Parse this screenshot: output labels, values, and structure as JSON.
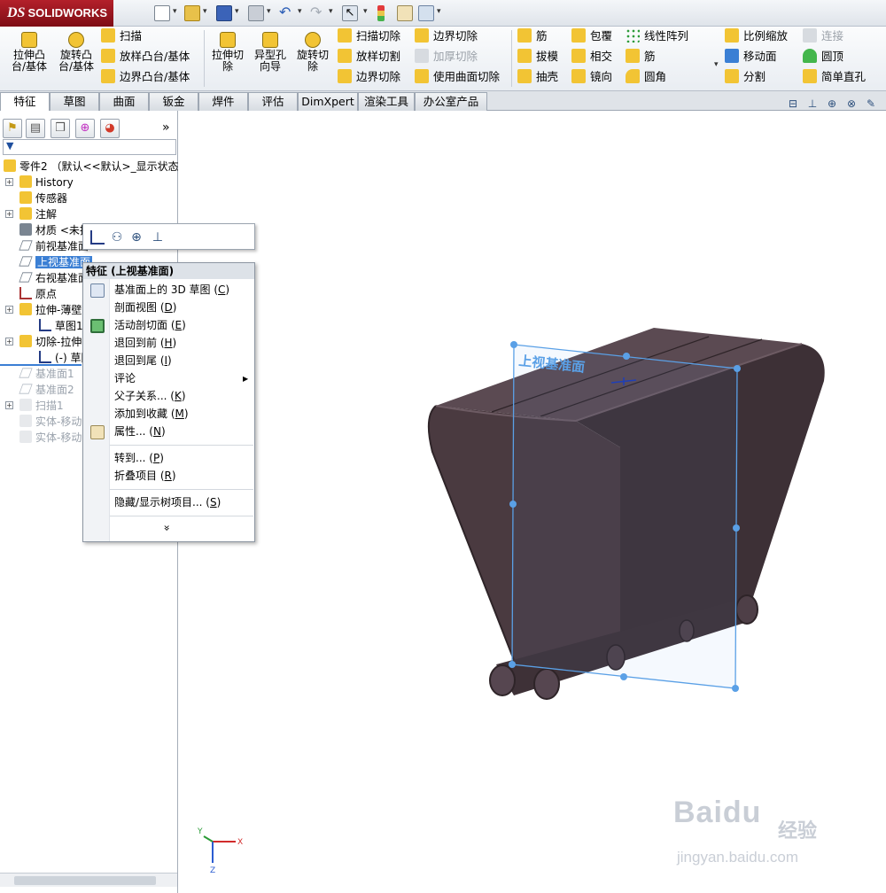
{
  "app": {
    "logo_text": "SOLIDWORKS",
    "logo_mark": "DS"
  },
  "titlebar_icons": [
    "new-icon",
    "open-icon",
    "save-icon",
    "print-icon",
    "undo-icon",
    "redo-icon",
    "select-icon",
    "traffic-light-icon",
    "options-icon",
    "customize-icon"
  ],
  "command_manager": {
    "big_buttons": [
      {
        "label1": "拉伸凸",
        "label2": "台/基体",
        "icon": "extrude-boss-icon"
      },
      {
        "label1": "旋转凸",
        "label2": "台/基体",
        "icon": "revolve-boss-icon"
      },
      {
        "label1": "拉伸切",
        "label2": "除",
        "icon": "extruded-cut-icon"
      },
      {
        "label1": "异型孔",
        "label2": "向导",
        "icon": "hole-wizard-icon"
      },
      {
        "label1": "旋转切",
        "label2": "除",
        "icon": "revolved-cut-icon"
      }
    ],
    "small_buttons": {
      "sweep": "扫描",
      "loft": "放样凸台/基体",
      "boundary_boss": "边界凸台/基体",
      "swept_cut": "扫描切除",
      "lofted_cut": "放样切割",
      "boundary_cut_left": "边界切除",
      "boundary_cut_top": "边界切除",
      "thicken_cut": "加厚切除",
      "surface_cut": "使用曲面切除",
      "rib1": "筋",
      "draft": "拔模",
      "shell": "抽壳",
      "wrap": "包覆",
      "intersect": "相交",
      "mirror": "镜向",
      "linear_pattern": "线性阵列",
      "rib2": "筋",
      "fillet": "圆角",
      "scale": "比例缩放",
      "move_body": "移动面",
      "split": "分割",
      "connect": "连接",
      "dome": "圆顶",
      "simple_hole": "简单直孔"
    }
  },
  "tabs": [
    "特征",
    "草图",
    "曲面",
    "钣金",
    "焊件",
    "评估",
    "DimXpert",
    "渲染工具",
    "办公室产品"
  ],
  "feature_tree": {
    "root": "零件2 （默认<<默认>_显示状态",
    "items": [
      {
        "label": "History",
        "icon": "history-icon",
        "faded": false
      },
      {
        "label": "传感器",
        "icon": "sensor-icon",
        "faded": false
      },
      {
        "label": "注解",
        "icon": "annotation-icon",
        "faded": false
      },
      {
        "label": "材质 <未指",
        "icon": "material-icon",
        "faded": false
      },
      {
        "label": "前视基准面",
        "icon": "plane-icon",
        "faded": false
      },
      {
        "label": "上视基准面",
        "icon": "plane-icon",
        "faded": false
      },
      {
        "label": "右视基准面",
        "icon": "plane-icon",
        "faded": false
      },
      {
        "label": "原点",
        "icon": "origin-icon",
        "faded": false
      },
      {
        "label": "拉伸-薄壁",
        "icon": "extrude-feature-icon",
        "faded": false
      },
      {
        "label": "草图1",
        "icon": "sketch-icon",
        "faded": false
      },
      {
        "label": "切除-拉伸",
        "icon": "cut-feature-icon",
        "faded": false
      },
      {
        "label": "(-) 草图",
        "icon": "sketch-icon",
        "faded": false
      },
      {
        "label": "基准面1",
        "icon": "plane-icon",
        "faded": true
      },
      {
        "label": "基准面2",
        "icon": "plane-icon",
        "faded": true
      },
      {
        "label": "扫描1",
        "icon": "sweep-feature-icon",
        "faded": true
      },
      {
        "label": "实体-移动",
        "icon": "move-body-icon",
        "faded": true
      },
      {
        "label": "实体-移动",
        "icon": "move-body-icon",
        "faded": true
      }
    ]
  },
  "context_toolbar": [
    "sketch-icon",
    "normal-to-icon",
    "zoom-to-selection-icon",
    "plane-edit-icon"
  ],
  "context_menu": {
    "header": "特征 (上视基准面)",
    "items": [
      {
        "label": "基准面上的 3D 草图 (",
        "hotkey": "C",
        "end": ")"
      },
      {
        "label": "剖面视图 (",
        "hotkey": "D",
        "end": ")"
      },
      {
        "label": "活动剖切面 (",
        "hotkey": "E",
        "end": ")"
      },
      {
        "label": "退回到前 (",
        "hotkey": "H",
        "end": ")"
      },
      {
        "label": "退回到尾 (",
        "hotkey": "I",
        "end": ")"
      },
      {
        "label": "评论",
        "hotkey": "",
        "end": ""
      },
      {
        "label": "父子关系... (",
        "hotkey": "K",
        "end": ")"
      },
      {
        "label": "添加到收藏 (",
        "hotkey": "M",
        "end": ")"
      },
      {
        "label": "属性... (",
        "hotkey": "N",
        "end": ")"
      },
      {
        "label": "转到... (",
        "hotkey": "P",
        "end": ")"
      },
      {
        "label": "折叠项目 (",
        "hotkey": "R",
        "end": ")"
      },
      {
        "label": "隐藏/显示树项目... (",
        "hotkey": "S",
        "end": ")"
      }
    ],
    "expand": "»"
  },
  "viewport": {
    "plane_label": "上视基准面",
    "triad": {
      "x": "X",
      "y": "Y",
      "z": "Z"
    }
  },
  "watermark": {
    "main": "Baidu",
    "sub": "经验",
    "url": "jingyan.baidu.com"
  },
  "colors": {
    "model": "#4a3a40",
    "model_edge": "#2e2428",
    "plane": "#5aa0e6",
    "annotation_arrow": "#ff44dd",
    "selection": "#3b7fd4"
  }
}
